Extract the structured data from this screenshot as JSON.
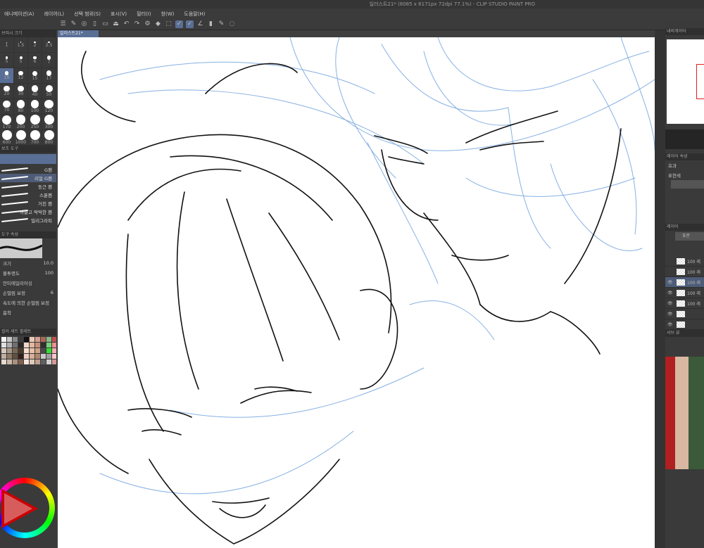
{
  "window": {
    "title": "일러스트21* (8085 x 6171px 72dpi 77.1%)  - CLIP STUDIO PAINT PRO"
  },
  "menu": [
    "애니메이션(A)",
    "레이어(L)",
    "선택 범위(S)",
    "표시(V)",
    "필터(I)",
    "창(W)",
    "도움말(H)"
  ],
  "toolbar_icons": [
    "menu-icon",
    "pen-icon",
    "circle-icon",
    "new-file-icon",
    "open-icon",
    "save-icon",
    "undo-icon",
    "redo-icon",
    "gear-icon",
    "fill-icon",
    "transform-icon",
    "check-icon",
    "check-icon",
    "ruler-icon",
    "phone-icon",
    "pen-icon",
    "lasso-icon"
  ],
  "left": {
    "brush_size_title": "브러시 크기",
    "sizes": [
      "1",
      "1.5",
      "2",
      "2.5",
      "5",
      "5",
      "6",
      "7",
      "10",
      "12",
      "15",
      "17",
      "20",
      "30",
      "40",
      "50",
      "70",
      "80",
      "100",
      "120",
      "170",
      "200",
      "250",
      "300",
      "600",
      "1000",
      "700",
      "800"
    ],
    "sub_tool_title": "보조 도구",
    "brushes": [
      "G펜",
      "리얼 G펜",
      "둥근 펜",
      "스푼펜",
      "거친 펜",
      "까끌고 딱딱한 펜",
      "밀리그라피"
    ],
    "selected_brush": 1,
    "tool_property_title": "도구 속성",
    "props": [
      {
        "label": "크기",
        "value": "10.0"
      },
      {
        "label": "불투명도",
        "value": "100"
      },
      {
        "label": "안티에일리어싱",
        "value": ""
      },
      {
        "label": "손떨림 보정",
        "value": "6"
      },
      {
        "label": "속도에 의한 손떨림 보정",
        "value": ""
      },
      {
        "label": "흡착",
        "value": ""
      }
    ],
    "color_set_title": "컬러 세트 팔레트",
    "palette": [
      "#f5f5f5",
      "#c8c8c8",
      "#8a8a8a",
      "#3c3c3c",
      "#111",
      "#e8c8b8",
      "#d4a090",
      "#a86858",
      "#8ab88a",
      "#c05050",
      "#e0e0e0",
      "#b0b0b0",
      "#707070",
      "#282828",
      "#f0d8c8",
      "#e0b8a0",
      "#c89078",
      "#303030",
      "#7ad07a",
      "#e89090",
      "#d8c8c0",
      "#a89888",
      "#786858",
      "#483828",
      "#f8e0d0",
      "#e8c0a8",
      "#d0a088",
      "#4a4a4a",
      "#30e030",
      "#f0b0b0",
      "#c0b0a0",
      "#907868",
      "#605040",
      "#302018",
      "#f0d0c0",
      "#d8b098",
      "#b08870",
      "#c8c8c8",
      "#a0a0a0",
      "#f8c8c8",
      "#e8d8d0",
      "#c8b8a8",
      "#a89080",
      "#806050",
      "#f8e8e0",
      "#e0c8b8",
      "#c0a090",
      "#606060",
      "#d0d0d0",
      "#d89898"
    ],
    "brush_preview": "G펜"
  },
  "document": {
    "tab": "일러스트21*"
  },
  "right": {
    "navigator_title": "내비게이터",
    "layer_property_title": "레이어 속성",
    "effect_label": "효과",
    "color_label": "표현색",
    "layer_panel_title": "레이어",
    "blend_mode": "표준",
    "layers": [
      {
        "name": "100 레",
        "visible": false,
        "selected": false
      },
      {
        "name": "100 레",
        "visible": false,
        "selected": false
      },
      {
        "name": "100 레",
        "visible": true,
        "selected": true
      },
      {
        "name": "100 레",
        "visible": true,
        "selected": false
      },
      {
        "name": "100 레",
        "visible": true,
        "selected": false
      },
      {
        "name": "",
        "visible": true,
        "selected": false
      },
      {
        "name": "",
        "visible": true,
        "selected": false
      }
    ],
    "sub_panel_title": "서브 뷰"
  },
  "colors": {
    "accent": "#5a6f96",
    "sketch_blue": "#7aa8e0",
    "ink": "#111111"
  }
}
